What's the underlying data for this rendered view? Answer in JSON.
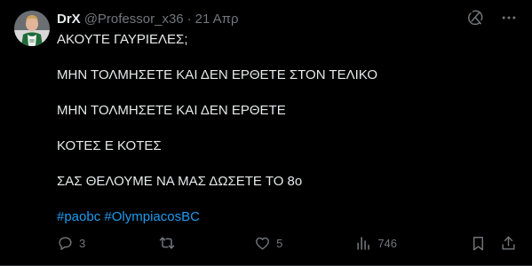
{
  "tweet": {
    "author": {
      "display_name": "DrX",
      "handle": "@Professor_x36",
      "avatar_icon": "player-avatar"
    },
    "separator": "·",
    "date": "21 Απρ",
    "header_icons": [
      "grok-icon",
      "more-icon"
    ],
    "text_lines": [
      "ΑΚΟΥΤΕ ΓΑΥΡΙΕΛΕΣ;",
      "ΜΗΝ ΤΟΛΜΗΣΕΤΕ ΚΑΙ ΔΕΝ ΕΡΘΕΤΕ ΣΤΟΝ ΤΕΛΙΚΟ",
      "ΜΗΝ ΤΟΛΜΗΣΕΤΕ ΚΑΙ ΔΕΝ ΕΡΘΕΤΕ",
      "ΚΟΤΕΣ Ε ΚΟΤΕΣ",
      "ΣΑΣ ΘΕΛΟΥΜΕ ΝΑ ΜΑΣ ΔΩΣΕΤΕ ΤΟ 8ο"
    ],
    "hashtags": [
      "#paobc",
      "#OlympiacosBC"
    ],
    "stats": {
      "replies": "3",
      "retweets": "",
      "likes": "5",
      "views": "746"
    }
  },
  "colors": {
    "background": "#000000",
    "text": "#e7e9ea",
    "muted": "#71767b",
    "accent": "#1d9bf0",
    "divider": "#2f3336"
  }
}
